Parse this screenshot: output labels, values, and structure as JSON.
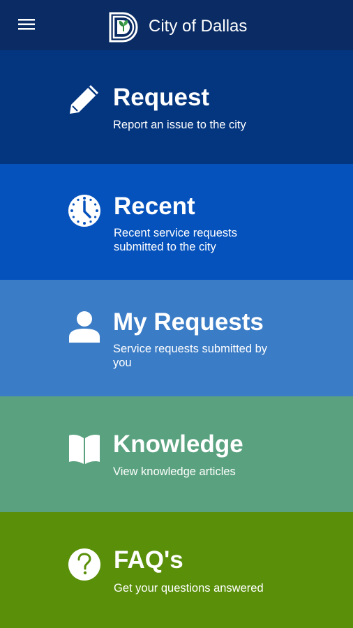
{
  "header": {
    "title": "City of Dallas",
    "menu_icon": "hamburger-menu-icon",
    "logo": "city-of-dallas-logo",
    "background": "#0a2b63"
  },
  "tiles": [
    {
      "title": "Request",
      "description": "Report an issue to the city",
      "icon": "pencil-icon",
      "color": "#043680"
    },
    {
      "title": "Recent",
      "description": "Recent service requests submitted to the city",
      "icon": "clock-icon",
      "color": "#0652bc"
    },
    {
      "title": "My Requests",
      "description": "Service requests submitted by you",
      "icon": "person-icon",
      "color": "#3b7cc6"
    },
    {
      "title": "Knowledge",
      "description": "View knowledge articles",
      "icon": "book-icon",
      "color": "#5aa27f"
    },
    {
      "title": "FAQ's",
      "description": "Get your questions answered",
      "icon": "question-icon",
      "color": "#5a8f0a"
    }
  ]
}
